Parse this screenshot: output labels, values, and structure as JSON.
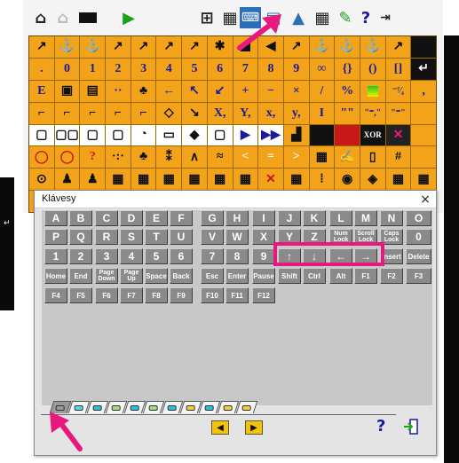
{
  "dialog": {
    "title": "Klávesy",
    "close_glyph": "×"
  },
  "keyboard": {
    "row1": [
      "A",
      "B",
      "C",
      "D",
      "E",
      "F",
      "G",
      "H",
      "I",
      "J",
      "K",
      "L",
      "M",
      "N",
      "O"
    ],
    "row2": [
      "P",
      "Q",
      "R",
      "S",
      "T",
      "U",
      "V",
      "W",
      "X",
      "Y",
      "Z",
      "Num Lock",
      "Scroll Lock",
      "Caps Lock",
      "0"
    ],
    "row3": [
      "1",
      "2",
      "3",
      "4",
      "5",
      "6",
      "7",
      "8",
      "9",
      "↑",
      "↓",
      "←",
      "→",
      "Insert",
      "Delete"
    ],
    "row4": [
      "Home",
      "End",
      "Page Down",
      "Page Up",
      "Space",
      "Back",
      "Esc",
      "Enter",
      "Pause",
      "Shift",
      "Ctrl",
      "Alt",
      "F1",
      "F2",
      "F3"
    ],
    "row5": [
      "F4",
      "F5",
      "F6",
      "F7",
      "F8",
      "F9",
      "F10",
      "F11",
      "F12"
    ]
  },
  "palette": {
    "row2": [
      ".",
      "0",
      "1",
      "2",
      "3",
      "4",
      "5",
      "6",
      "7",
      "8",
      "9",
      "∞",
      "{}",
      "()",
      "[]",
      ""
    ],
    "row3": [
      "E",
      "",
      "",
      "··",
      "",
      "←",
      "↖",
      "↙",
      "+",
      "−",
      "×",
      "/",
      "%",
      "",
      "⁻⁷⁄₄",
      ","
    ],
    "row4": [
      "",
      "",
      "",
      "",
      "",
      "",
      "",
      "X,",
      "Y,",
      "x,",
      "y,",
      "I",
      "\"\"",
      "\"⁼,\"",
      "\"⁼\"",
      ""
    ],
    "row5": [
      "",
      "",
      "",
      "",
      "",
      "",
      "",
      "",
      "",
      "",
      "",
      "",
      "",
      "XOR",
      "",
      ""
    ],
    "row6": [
      "",
      "",
      "?",
      "",
      "",
      "",
      "",
      "",
      "<",
      "=",
      ">",
      "",
      "",
      "",
      "#",
      ""
    ],
    "toolbar_help": "?"
  },
  "controls": {
    "help": "?",
    "prev_page": "◀",
    "next_page": "▶"
  },
  "colors": {
    "highlight": "#e8187e",
    "palette_cell": "#f2a31a",
    "key_face": "#8a8a8a"
  }
}
